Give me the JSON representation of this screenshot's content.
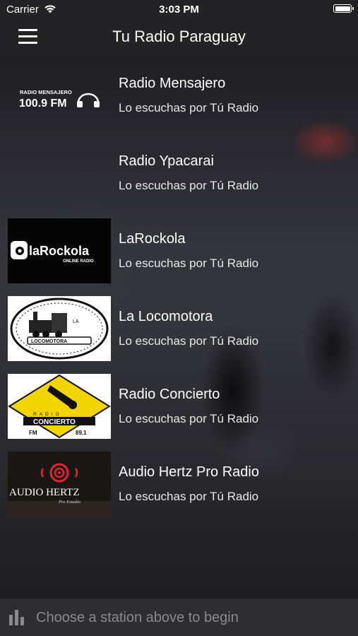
{
  "status_bar": {
    "carrier": "Carrier",
    "time": "3:03 PM"
  },
  "nav": {
    "title": "Tu Radio Paraguay"
  },
  "stations": [
    {
      "name": "Radio Mensajero",
      "subtitle": "Lo escuchas por Tú Radio",
      "logo_line1": "RADIO MENSAJERO",
      "logo_line2": "100.9 FM"
    },
    {
      "name": "Radio Ypacarai",
      "subtitle": "Lo escuchas por Tú Radio"
    },
    {
      "name": "LaRockola",
      "subtitle": "Lo escuchas por Tú Radio",
      "logo_line1": "laRockola",
      "logo_line2": "ONLINE RADIO"
    },
    {
      "name": "La Locomotora",
      "subtitle": "Lo escuchas por Tú Radio",
      "logo_line1": "LA",
      "logo_line2": "LOCOMOTORA"
    },
    {
      "name": "Radio Concierto",
      "subtitle": "Lo escuchas por Tú Radio",
      "logo_line1": "RADIO",
      "logo_line2": "CONCIERTO",
      "logo_line3": "FM",
      "logo_line4": "89.1"
    },
    {
      "name": "Audio Hertz Pro Radio",
      "subtitle": "Lo escuchas por Tú Radio",
      "logo_line1": "AUDIO HERTZ",
      "logo_line2": "Pro Estudio"
    }
  ],
  "player": {
    "prompt": "Choose a station above to begin"
  },
  "colors": {
    "bar_bg": "#232326",
    "player_bg": "#2e2e32",
    "muted_text": "#8a8a8e",
    "audio_hertz_red": "#e0262e"
  }
}
